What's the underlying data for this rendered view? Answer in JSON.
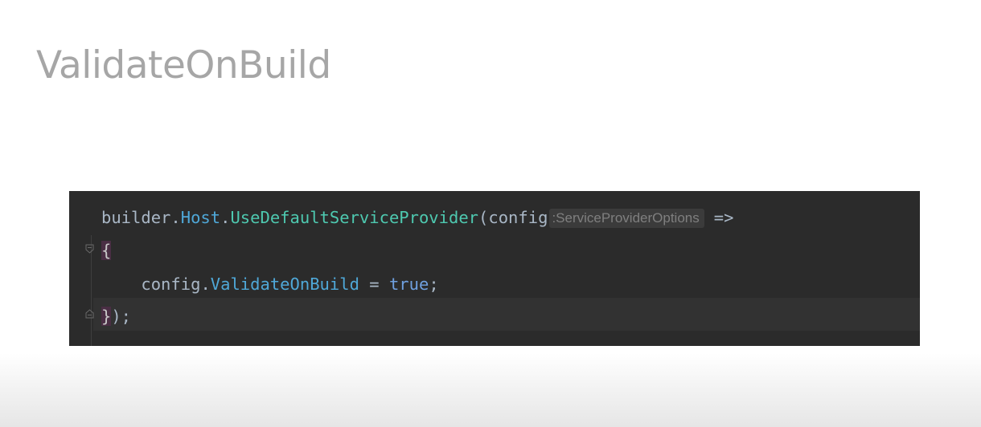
{
  "slide": {
    "title": "ValidateOnBuild"
  },
  "code": {
    "line1": {
      "receiver": "builder",
      "dot1": ".",
      "member": "Host",
      "dot2": ".",
      "method": "UseDefaultServiceProvider",
      "paren": "(",
      "param": "config",
      "type_hint": ":ServiceProviderOptions",
      "arrow": "=>"
    },
    "line2": {
      "open_brace": "{"
    },
    "line3": {
      "indent": "    ",
      "target": "config",
      "dot": ".",
      "property": "ValidateOnBuild",
      "assign": " = ",
      "value": "true",
      "semicolon": ";"
    },
    "line4": {
      "close_brace": "}",
      "tail": ");"
    }
  },
  "colors": {
    "editor_background": "#2b2b2b",
    "plain_text": "#a9b7c6",
    "member": "#4fa8d8",
    "method": "#4ec9b0",
    "keyword": "#6fa0e0",
    "brace_highlight": "#4a2e44",
    "inlay_hint_text": "#7f7f7f",
    "title_text": "#a6a6a6"
  },
  "icons": {
    "fold_open": "fold-start-icon",
    "fold_close": "fold-end-icon"
  }
}
